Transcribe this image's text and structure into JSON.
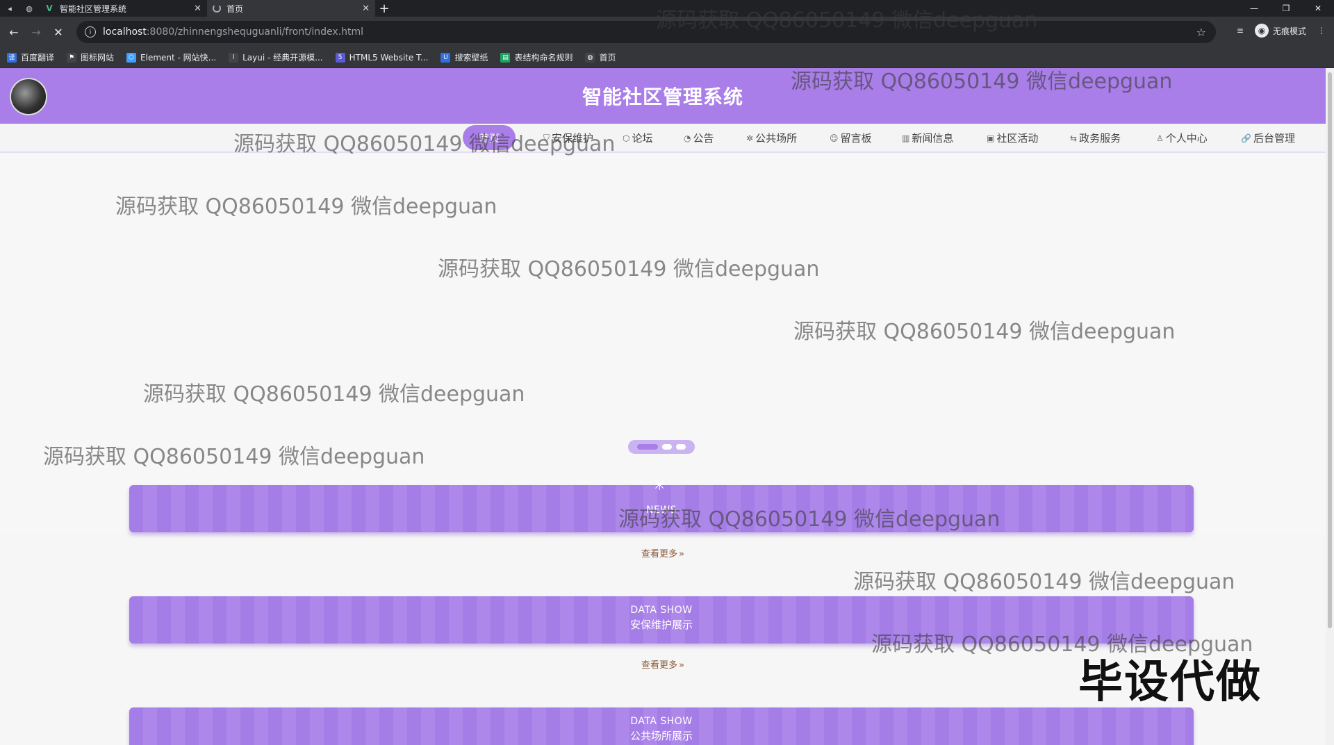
{
  "browser": {
    "tabs": [
      {
        "title": "智能社区管理系统",
        "favicon": "vue-icon"
      },
      {
        "title": "首页",
        "favicon": "loading-spinner-icon"
      }
    ],
    "new_tab": "+",
    "address": {
      "host": "localhost",
      "path": ":8080/zhinnengshequguanli/front/index.html"
    },
    "incognito_label": "无痕模式",
    "bookmarks": [
      {
        "label": "百度翻译",
        "color": "#2f6fe0"
      },
      {
        "label": "图标网站",
        "color": "#444444"
      },
      {
        "label": "Element - 网站快...",
        "color": "#409eff"
      },
      {
        "label": "Layui - 经典开源模...",
        "color": "#444444"
      },
      {
        "label": "HTML5 Website T...",
        "color": "#5a5ad6"
      },
      {
        "label": "搜索壁纸",
        "color": "#2f6fe0"
      },
      {
        "label": "表结构命名规则",
        "color": "#1fa463"
      },
      {
        "label": "首页",
        "color": "#444444"
      }
    ]
  },
  "site": {
    "title": "智能社区管理系统",
    "accent": "#a97ee9",
    "nav": [
      {
        "label": "首页",
        "icon": "home-icon"
      },
      {
        "label": "安保维护",
        "icon": "shield-icon"
      },
      {
        "label": "论坛",
        "icon": "forum-icon"
      },
      {
        "label": "公告",
        "icon": "notice-icon"
      },
      {
        "label": "公共场所",
        "icon": "place-icon"
      },
      {
        "label": "留言板",
        "icon": "message-icon"
      },
      {
        "label": "新闻信息",
        "icon": "news-icon"
      },
      {
        "label": "社区活动",
        "icon": "activity-icon"
      },
      {
        "label": "政务服务",
        "icon": "service-icon"
      },
      {
        "label": "个人中心",
        "icon": "user-icon"
      },
      {
        "label": "后台管理",
        "icon": "link-icon"
      }
    ]
  },
  "sections": [
    {
      "en": "NEWS",
      "zh": "",
      "more": "查看更多"
    },
    {
      "en": "DATA SHOW",
      "zh": "安保维护展示",
      "more": "查看更多"
    },
    {
      "en": "DATA SHOW",
      "zh": "公共场所展示",
      "more": ""
    }
  ],
  "overlay": {
    "watermark": "源码获取 QQ86050149 微信deepguan",
    "stamp": "毕设代做"
  }
}
